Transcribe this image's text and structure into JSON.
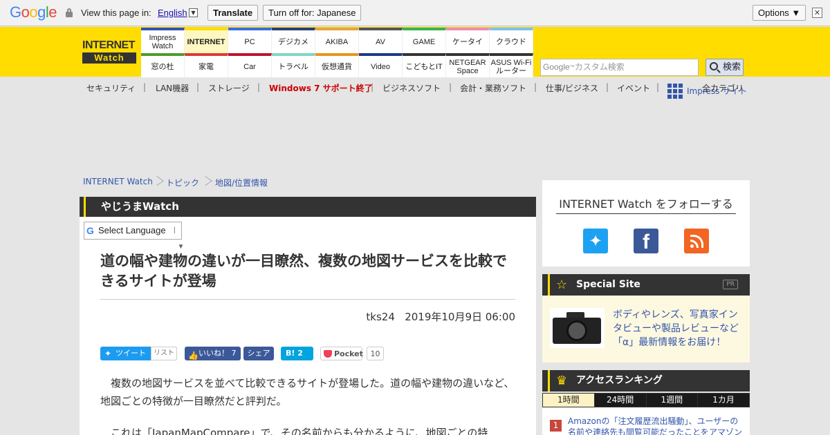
{
  "translate_bar": {
    "view_text": "View this page in:",
    "language": "English",
    "translate_label": "Translate",
    "turn_off_label": "Turn off for: Japanese",
    "options_label": "Options ▼",
    "close_label": "✕"
  },
  "header": {
    "logo_line1": "INTERNET",
    "logo_line2": "Watch",
    "nav": [
      {
        "label": "Impress Watch",
        "color": "#3355aa"
      },
      {
        "label": "INTERNET",
        "color": "#ffdd00"
      },
      {
        "label": "PC",
        "color": "#3b6fd8"
      },
      {
        "label": "デジカメ",
        "color": "#2b3f70"
      },
      {
        "label": "AKIBA",
        "color": "#e8a43c"
      },
      {
        "label": "AV",
        "color": "#555555"
      },
      {
        "label": "GAME",
        "color": "#39b54a"
      },
      {
        "label": "ケータイ",
        "color": "#f08cb0"
      },
      {
        "label": "クラウド",
        "color": "#7fc2e8"
      },
      {
        "label": "窓の杜",
        "color": "#4a9c2a"
      },
      {
        "label": "家電",
        "color": "#d93a3a"
      },
      {
        "label": "Car",
        "color": "#c0102c"
      },
      {
        "label": "トラベル",
        "color": "#7fd6c4"
      },
      {
        "label": "仮想通貨",
        "color": "#e8951c"
      },
      {
        "label": "Video",
        "color": "#1a3a8c"
      },
      {
        "label": "こどもとIT",
        "color": "#333333"
      },
      {
        "label": "NETGEAR Space",
        "color": "#333333"
      },
      {
        "label": "ASUS Wi-Fiルーター",
        "color": "#333333"
      }
    ],
    "search_logo": "Google",
    "search_placeholder": "カスタム検索",
    "search_button": "検索",
    "impress_link": "Impress サイト"
  },
  "categories": [
    {
      "label": "セキュリティ",
      "highlight": false
    },
    {
      "label": "LAN機器",
      "highlight": false
    },
    {
      "label": "ストレージ",
      "highlight": false
    },
    {
      "label": "Windows 7 サポート終了",
      "highlight": true
    },
    {
      "label": "ビジネスソフト",
      "highlight": false
    },
    {
      "label": "会計・業務ソフト",
      "highlight": false
    },
    {
      "label": "仕事/ビジネス",
      "highlight": false
    },
    {
      "label": "イベント",
      "highlight": false
    }
  ],
  "all_categories": "全カテゴリ",
  "breadcrumb": [
    "INTERNET Watch",
    "トピック",
    "地図/位置情報"
  ],
  "article": {
    "section": "やじうまWatch",
    "select_language": "Select Language",
    "title": "道の幅や建物の違いが一目瞭然、複数の地図サービスを比較できるサイトが登場",
    "author": "tks24",
    "date": "2019年10月9日 06:00",
    "social": {
      "tweet": "ツイート",
      "list": "リスト",
      "like": "いいね！ 7",
      "share": "シェア",
      "hatena": "B! 2",
      "pocket": "Pocket",
      "pocket_count": "10"
    },
    "para1": "複数の地図サービスを並べて比較できるサイトが登場した。道の幅や建物の違いなど、地図ごとの特徴が一目瞭然だと評判だ。",
    "para2": "これは「JapanMapCompare」で、その名前からも分かるように、地図ごとの特"
  },
  "sidebar": {
    "follow_title": "INTERNET Watch をフォローする",
    "special_title": "Special Site",
    "special_pr": "PR",
    "special_text": "ボディやレンズ、写真家インタビューや製品レビューなど「α」最新情報をお届け！",
    "ranking_title": "アクセスランキング",
    "ranking_tabs": [
      "1時間",
      "24時間",
      "1週間",
      "1カ月"
    ],
    "ranking_first_num": "1",
    "ranking_first": "Amazonの「注文履歴流出騒動」、ユーザーの名前や連絡先も閲覧可能だったことをアマゾン"
  }
}
